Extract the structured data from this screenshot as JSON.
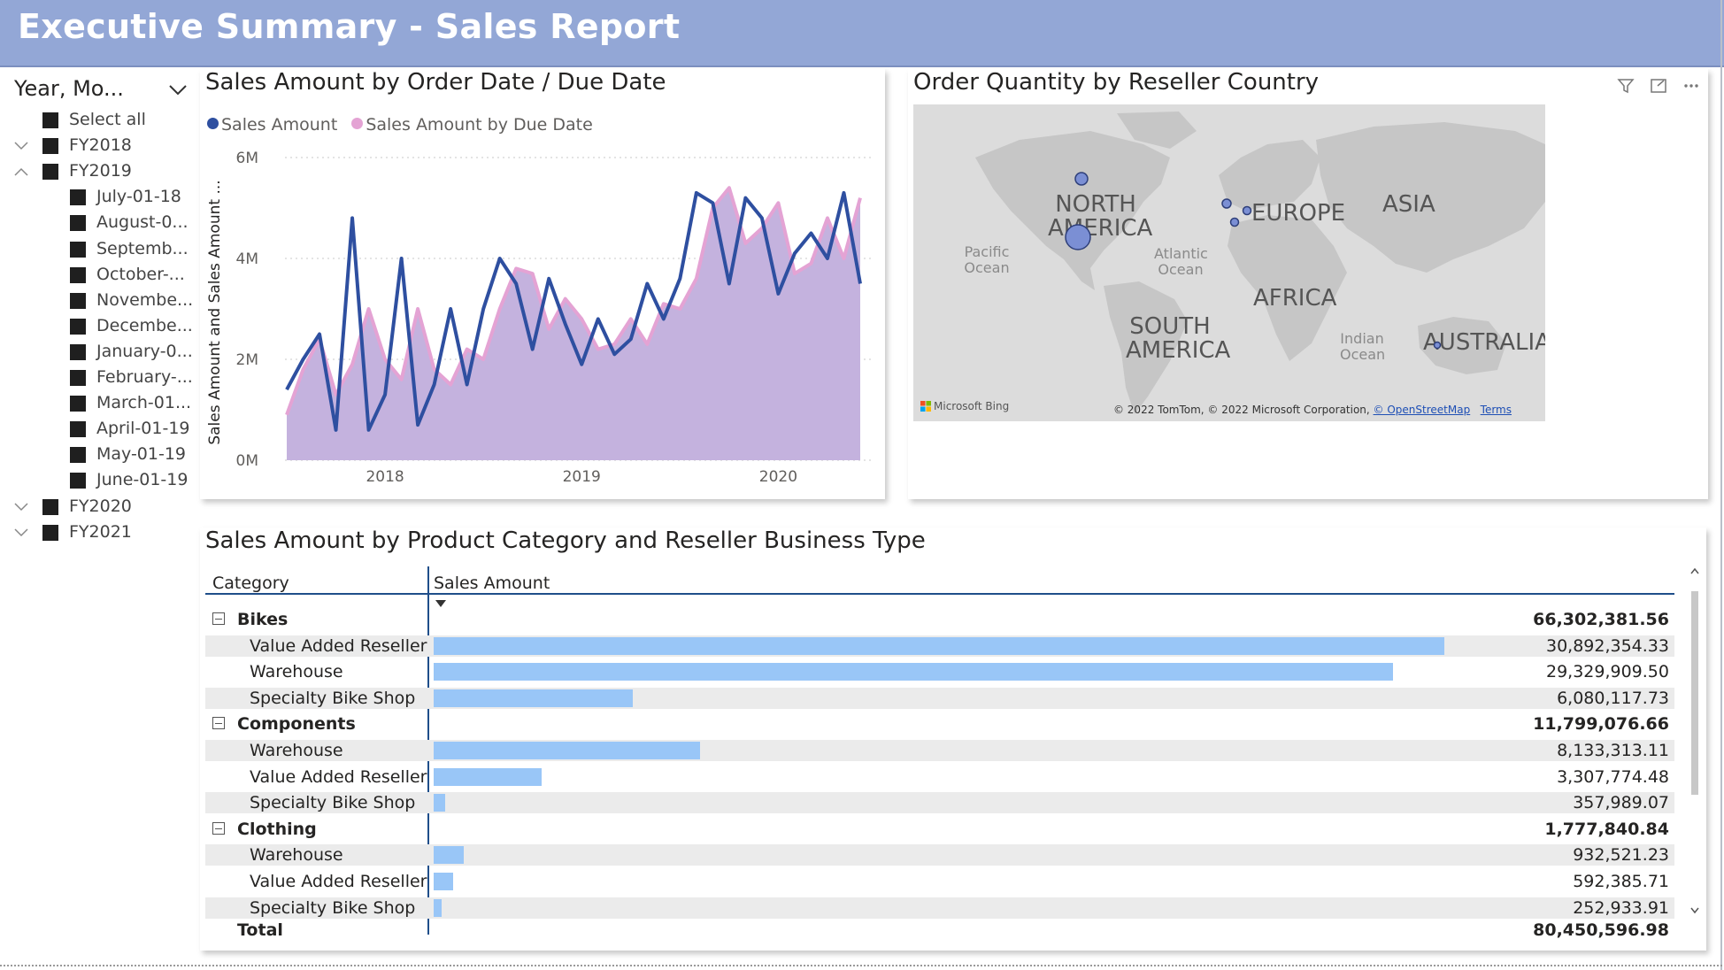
{
  "header": {
    "title": "Executive Summary - Sales Report"
  },
  "slicer": {
    "title": "Year, Mo...",
    "items": [
      {
        "label": "Select all",
        "level": 0,
        "expander": ""
      },
      {
        "label": "FY2018",
        "level": 0,
        "expander": "down"
      },
      {
        "label": "FY2019",
        "level": 0,
        "expander": "up"
      },
      {
        "label": "July-01-18",
        "level": 1,
        "expander": ""
      },
      {
        "label": "August-0...",
        "level": 1,
        "expander": ""
      },
      {
        "label": "Septemb...",
        "level": 1,
        "expander": ""
      },
      {
        "label": "October-...",
        "level": 1,
        "expander": ""
      },
      {
        "label": "Novembe...",
        "level": 1,
        "expander": ""
      },
      {
        "label": "Decembe...",
        "level": 1,
        "expander": ""
      },
      {
        "label": "January-0...",
        "level": 1,
        "expander": ""
      },
      {
        "label": "February-...",
        "level": 1,
        "expander": ""
      },
      {
        "label": "March-01...",
        "level": 1,
        "expander": ""
      },
      {
        "label": "April-01-19",
        "level": 1,
        "expander": ""
      },
      {
        "label": "May-01-19",
        "level": 1,
        "expander": ""
      },
      {
        "label": "June-01-19",
        "level": 1,
        "expander": ""
      },
      {
        "label": "FY2020",
        "level": 0,
        "expander": "down"
      },
      {
        "label": "FY2021",
        "level": 0,
        "expander": "down"
      }
    ]
  },
  "line_chart": {
    "title": "Sales Amount by Order Date / Due Date",
    "legend": [
      {
        "name": "Sales Amount",
        "color": "#2e4fa0"
      },
      {
        "name": "Sales Amount by Due Date",
        "color": "#e4a3d4"
      }
    ]
  },
  "chart_data": {
    "type": "area",
    "title": "Sales Amount by Order Date / Due Date",
    "ylabel": "Sales Amount and Sales Amount ...",
    "xlabel": "",
    "ylim": [
      0,
      6000000
    ],
    "yticks": [
      "0M",
      "2M",
      "4M",
      "6M"
    ],
    "xticks": [
      "2018",
      "2019",
      "2020"
    ],
    "x": [
      "2017-07",
      "2017-08",
      "2017-09",
      "2017-10",
      "2017-11",
      "2017-12",
      "2018-01",
      "2018-02",
      "2018-03",
      "2018-04",
      "2018-05",
      "2018-06",
      "2018-07",
      "2018-08",
      "2018-09",
      "2018-10",
      "2018-11",
      "2018-12",
      "2019-01",
      "2019-02",
      "2019-03",
      "2019-04",
      "2019-05",
      "2019-06",
      "2019-07",
      "2019-08",
      "2019-09",
      "2019-10",
      "2019-11",
      "2019-12",
      "2020-01",
      "2020-02",
      "2020-03",
      "2020-04",
      "2020-05",
      "2020-06"
    ],
    "series": [
      {
        "name": "Sales Amount",
        "color": "#2e4fa0",
        "style": "line",
        "values": [
          1400000,
          2000000,
          2500000,
          600000,
          4800000,
          600000,
          1300000,
          4000000,
          700000,
          1500000,
          3000000,
          1500000,
          3000000,
          4000000,
          3500000,
          2200000,
          3600000,
          2700000,
          1900000,
          2800000,
          2100000,
          2400000,
          3500000,
          2800000,
          3600000,
          5300000,
          5100000,
          3500000,
          5200000,
          4800000,
          3300000,
          4100000,
          4500000,
          4000000,
          5300000,
          3500000
        ]
      },
      {
        "name": "Sales Amount by Due Date",
        "color": "#e4a3d4",
        "style": "area",
        "fill": "#c4b2de",
        "values": [
          900000,
          1800000,
          2400000,
          1300000,
          1900000,
          3000000,
          2000000,
          1600000,
          3000000,
          1800000,
          1500000,
          2200000,
          2000000,
          3000000,
          3800000,
          3700000,
          2600000,
          3200000,
          2800000,
          2200000,
          2300000,
          2800000,
          2300000,
          3100000,
          3000000,
          3600000,
          5000000,
          5400000,
          4300000,
          4600000,
          5100000,
          3700000,
          3900000,
          4800000,
          4000000,
          5200000
        ]
      }
    ]
  },
  "map": {
    "title": "Order Quantity by Reseller Country",
    "continents": [
      "NORTH AMERICA",
      "EUROPE",
      "ASIA",
      "AFRICA",
      "SOUTH AMERICA",
      "AUSTRALIA"
    ],
    "oceans": [
      "Pacific Ocean",
      "Atlantic Ocean",
      "Indian Ocean"
    ],
    "attribution": "© 2022 TomTom, © 2022 Microsoft Corporation,",
    "osm_link": "© OpenStreetMap",
    "terms_link": "Terms",
    "logo_text": "Microsoft Bing",
    "bubble_color": "#7b8fd4",
    "icons": [
      "filter-icon",
      "focus-mode-icon",
      "more-options-icon"
    ]
  },
  "matrix": {
    "title": "Sales Amount by Product Category and Reseller Business Type",
    "col_category": "Category",
    "col_sales": "Sales Amount",
    "max_value": 30892354.33,
    "bar_color": "#99c6f7",
    "rows": [
      {
        "label": "Bikes",
        "value": "66,302,381.56",
        "num": 66302381.56,
        "group": true,
        "shaded": false
      },
      {
        "label": "Value Added Reseller",
        "value": "30,892,354.33",
        "num": 30892354.33,
        "group": false,
        "shaded": true
      },
      {
        "label": "Warehouse",
        "value": "29,329,909.50",
        "num": 29329909.5,
        "group": false,
        "shaded": false
      },
      {
        "label": "Specialty Bike Shop",
        "value": "6,080,117.73",
        "num": 6080117.73,
        "group": false,
        "shaded": true
      },
      {
        "label": "Components",
        "value": "11,799,076.66",
        "num": 11799076.66,
        "group": true,
        "shaded": false
      },
      {
        "label": "Warehouse",
        "value": "8,133,313.11",
        "num": 8133313.11,
        "group": false,
        "shaded": true
      },
      {
        "label": "Value Added Reseller",
        "value": "3,307,774.48",
        "num": 3307774.48,
        "group": false,
        "shaded": false
      },
      {
        "label": "Specialty Bike Shop",
        "value": "357,989.07",
        "num": 357989.07,
        "group": false,
        "shaded": true
      },
      {
        "label": "Clothing",
        "value": "1,777,840.84",
        "num": 1777840.84,
        "group": true,
        "shaded": false
      },
      {
        "label": "Warehouse",
        "value": "932,521.23",
        "num": 932521.23,
        "group": false,
        "shaded": true
      },
      {
        "label": "Value Added Reseller",
        "value": "592,385.71",
        "num": 592385.71,
        "group": false,
        "shaded": false
      },
      {
        "label": "Specialty Bike Shop",
        "value": "252,933.91",
        "num": 252933.91,
        "group": false,
        "shaded": true
      }
    ],
    "total_label": "Total",
    "total_value": "80,450,596.98"
  }
}
